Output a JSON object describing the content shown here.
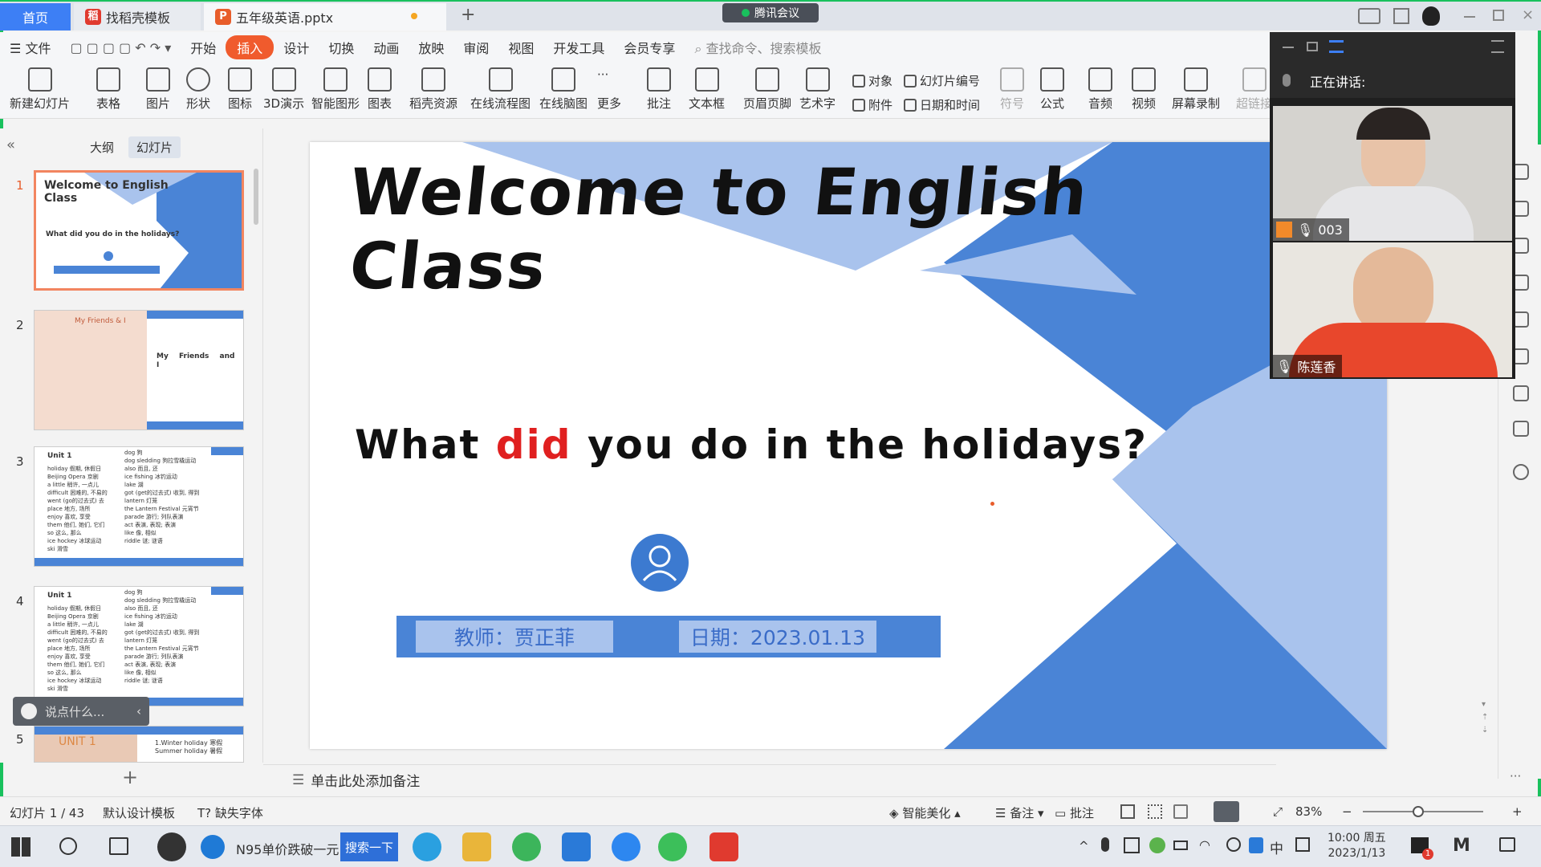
{
  "tabs": {
    "home": "首页",
    "template": "找稻壳模板",
    "document": "五年级英语.pptx",
    "add": "+"
  },
  "meeting_pill": "腾讯会议",
  "menu": {
    "file": "文件",
    "items": [
      "开始",
      "插入",
      "设计",
      "切换",
      "动画",
      "放映",
      "审阅",
      "视图",
      "开发工具",
      "会员专享"
    ],
    "active": "插入",
    "search": "查找命令、搜索模板"
  },
  "ribbon": {
    "big": [
      "新建幻灯片",
      "表格",
      "图片",
      "形状",
      "图标",
      "3D演示",
      "智能图形",
      "图表",
      "稻壳资源",
      "在线流程图",
      "在线脑图",
      "更多",
      "批注",
      "文本框",
      "页眉页脚",
      "艺术字"
    ],
    "small": {
      "object": "对象",
      "slide_number": "幻灯片编号",
      "attachment": "附件",
      "datetime": "日期和时间"
    },
    "big2": [
      "符号",
      "公式",
      "音频",
      "视频",
      "屏幕录制",
      "超链接"
    ]
  },
  "panel": {
    "outline": "大纲",
    "slides": "幻灯片",
    "add": "+"
  },
  "thumbs": [
    {
      "num": "1",
      "title": "Welcome to English Class",
      "sub": "What did you do in the holidays?"
    },
    {
      "num": "2",
      "header": "My Friends & I",
      "text": "My Friends and I"
    },
    {
      "num": "3",
      "unit": "Unit 1",
      "left": [
        "holiday 假期, 休假日",
        "Beijing Opera 京剧",
        "a little 稍许, 一点儿",
        "difficult 困难的, 不易的",
        "went (go的过去式) 去",
        "place 地方, 场所",
        "enjoy 喜欢, 享受",
        "them 他们, 她们, 它们",
        "so 这么, 那么",
        "ice hockey 冰球运动",
        "ski 滑雪"
      ],
      "right": [
        "dog 狗",
        "dog sledding 狗拉雪橇运动",
        "also 而且, 还",
        "ice fishing 冰钓运动",
        "lake 湖",
        "got (get的过去式) 收到, 得到",
        "lantern 灯笼",
        "the Lantern Festival 元宵节",
        "parade 游行; 列队表演",
        "act 表演, 表现; 表演",
        "like 像, 相似",
        "riddle 谜; 谜语"
      ]
    },
    {
      "num": "4",
      "unit": "Unit 1"
    },
    {
      "num": "5",
      "title": "UNIT 1",
      "lines": [
        "1.Winter holiday 寒假",
        "Summer holiday 暑假"
      ]
    }
  ],
  "slide": {
    "title1": "Welcome to English",
    "title2": "Class",
    "q_before": "What ",
    "q_red": "did",
    "q_after": " you do in the holidays?",
    "teacher": "教师：贾正菲",
    "date": "日期：2023.01.13"
  },
  "notes": "单击此处添加备注",
  "status": {
    "slide": "幻灯片 1 / 43",
    "template": "默认设计模板",
    "font": "缺失字体",
    "beautify": "智能美化",
    "notes": "备注",
    "comment": "批注",
    "zoom": "83%"
  },
  "meeting": {
    "speaking": "正在讲话:",
    "p1": "003",
    "p2": "陈莲香"
  },
  "chat": "说点什么...",
  "taskbar": {
    "ie_text": "N95单价跌破一元",
    "search_btn": "搜索一下",
    "ime": "中",
    "time": "10:00 周五",
    "date": "2023/1/13",
    "badge": "1"
  },
  "colors": {
    "accent": "#3d7ff5",
    "insert": "#f05b2d",
    "slide_blue": "#4a84d6",
    "light_blue": "#a9c3ed"
  }
}
